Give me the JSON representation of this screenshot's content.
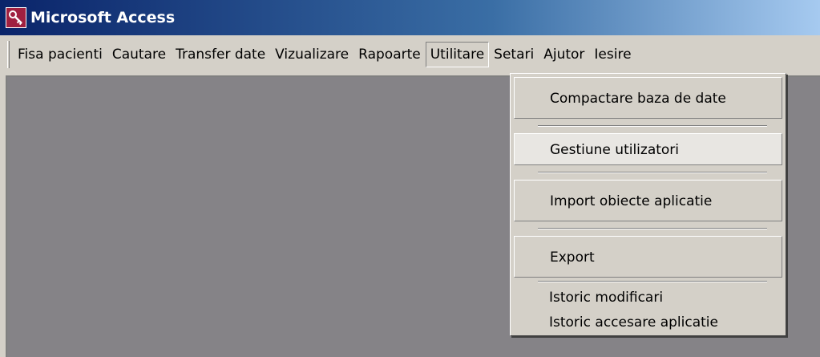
{
  "window": {
    "title": "Microsoft Access",
    "icon": "access-key-icon"
  },
  "menubar": {
    "items": [
      {
        "label": "Fisa pacienti"
      },
      {
        "label": "Cautare"
      },
      {
        "label": "Transfer date"
      },
      {
        "label": "Vizualizare"
      },
      {
        "label": "Rapoarte"
      },
      {
        "label": "Utilitare",
        "open": true
      },
      {
        "label": "Setari"
      },
      {
        "label": "Ajutor"
      },
      {
        "label": "Iesire"
      }
    ]
  },
  "dropdown": {
    "parent": "Utilitare",
    "items": [
      {
        "label": "Compactare baza de date"
      },
      {
        "label": "Gestiune utilizatori",
        "highlighted": true
      },
      {
        "label": "Import obiecte aplicatie"
      },
      {
        "label": "Export"
      },
      {
        "label": "Istoric modificari"
      },
      {
        "label": "Istoric accesare aplicatie"
      }
    ]
  },
  "colors": {
    "titlebar_start": "#0a246a",
    "titlebar_end": "#a6caf0",
    "chrome": "#d4d0c8",
    "client_background": "#858387",
    "icon_accent": "#a02040"
  }
}
